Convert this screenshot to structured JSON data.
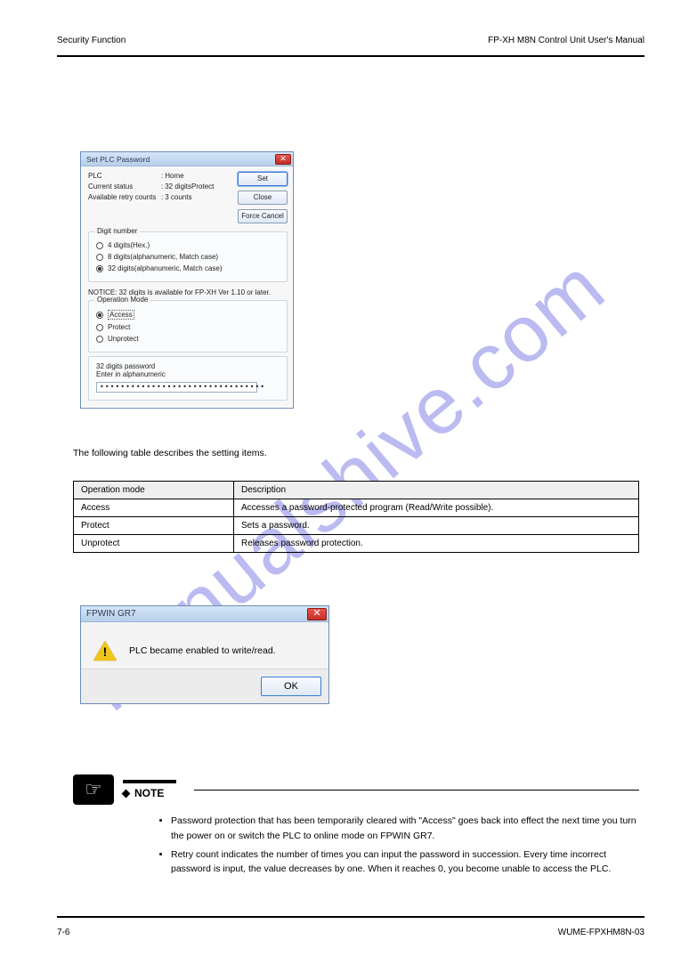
{
  "header": {
    "left": "Security Function",
    "right": "FP-XH M8N Control Unit User's Manual"
  },
  "footer": {
    "left": "7-6",
    "right": "WUME-FPXHM8N-03"
  },
  "watermark": "manualshive.com",
  "dlg1": {
    "title": "Set PLC Password",
    "buttons": {
      "set": "Set",
      "close": "Close",
      "force": "Force Cancel"
    },
    "plc_label": "PLC",
    "plc_sep": ":",
    "plc_value": "Home",
    "status_label": "Current status",
    "status_value": "32 digitsProtect",
    "retry_label": "Available retry counts",
    "retry_value": "3 counts",
    "group_digit": "Digit number",
    "digit_opts": {
      "d4": "4 digits(Hex.)",
      "d8": "8 digits(alphanumeric, Match case)",
      "d32": "32 digits(alphanumeric, Match case)"
    },
    "notice": "NOTICE: 32 digits is available for FP-XH Ver 1.10 or later.",
    "group_op": "Operation Mode",
    "op_opts": {
      "access": "Access",
      "protect": "Protect",
      "unprotect": "Unprotect"
    },
    "pw_title": "32 digits password",
    "pw_hint": "Enter in alphanumeric",
    "pw_value": "••••••••••••••••••••••••••••••••"
  },
  "desc": "The following table describes the setting items.",
  "table": {
    "head": {
      "mode": "Operation mode",
      "desc": "Description"
    },
    "rows": [
      {
        "mode": "Access",
        "desc": "Accesses a password-protected program (Read/Write possible)."
      },
      {
        "mode": "Protect",
        "desc": "Sets a password."
      },
      {
        "mode": "Unprotect",
        "desc": "Releases password protection."
      }
    ]
  },
  "dlg2": {
    "title": "FPWIN GR7",
    "message": "PLC became enabled to write/read.",
    "ok": "OK"
  },
  "note": {
    "label": "NOTE",
    "bullets": [
      "Password protection that has been temporarily cleared with \"Access\" goes back into effect the next time you turn the power on or switch the PLC to online mode on FPWIN GR7.",
      "Retry count indicates the number of times you can input the password in succession. Every time incorrect password is input, the value decreases by one. When it reaches 0, you become unable to access the PLC."
    ]
  }
}
